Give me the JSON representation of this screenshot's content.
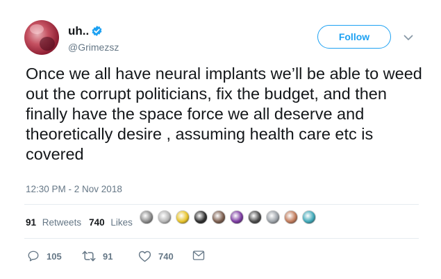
{
  "author": {
    "display_name": "uh..",
    "handle": "@Grimezsz",
    "avatar_icon": "profile-avatar",
    "verified_icon": "verified-badge-icon",
    "verified_color": "#1da1f2"
  },
  "follow_button": {
    "label": "Follow",
    "color": "#1da1f2"
  },
  "tweet": {
    "text": "Once we all have neural implants we’ll be able to weed out the corrupt politicians, fix the budget, and then finally have the space force we all deserve and theoretically desire , assuming health care etc is covered",
    "timestamp": "12:30 PM - 2 Nov 2018"
  },
  "stats": {
    "retweets_count": "91",
    "retweets_label": "Retweets",
    "likes_count": "740",
    "likes_label": "Likes"
  },
  "likers": [
    {
      "icon": "liker-avatar",
      "color": "#8a8a8a"
    },
    {
      "icon": "liker-avatar",
      "color": "#b5b5b5"
    },
    {
      "icon": "liker-avatar",
      "color": "#e6c229"
    },
    {
      "icon": "liker-avatar",
      "color": "#2d2d2d"
    },
    {
      "icon": "liker-avatar",
      "color": "#7a5c4d"
    },
    {
      "icon": "liker-avatar",
      "color": "#7b3aa0"
    },
    {
      "icon": "liker-avatar",
      "color": "#4a4a4a"
    },
    {
      "icon": "liker-avatar",
      "color": "#9aa0a6"
    },
    {
      "icon": "liker-avatar",
      "color": "#c07a5a"
    },
    {
      "icon": "liker-avatar",
      "color": "#3fa8b8"
    }
  ],
  "actions": {
    "reply_count": "105",
    "retweet_count": "91",
    "like_count": "740"
  },
  "colors": {
    "text_primary": "#14171a",
    "text_secondary": "#657786",
    "divider": "#e6ecf0",
    "retweet_green": "#17bf63"
  }
}
